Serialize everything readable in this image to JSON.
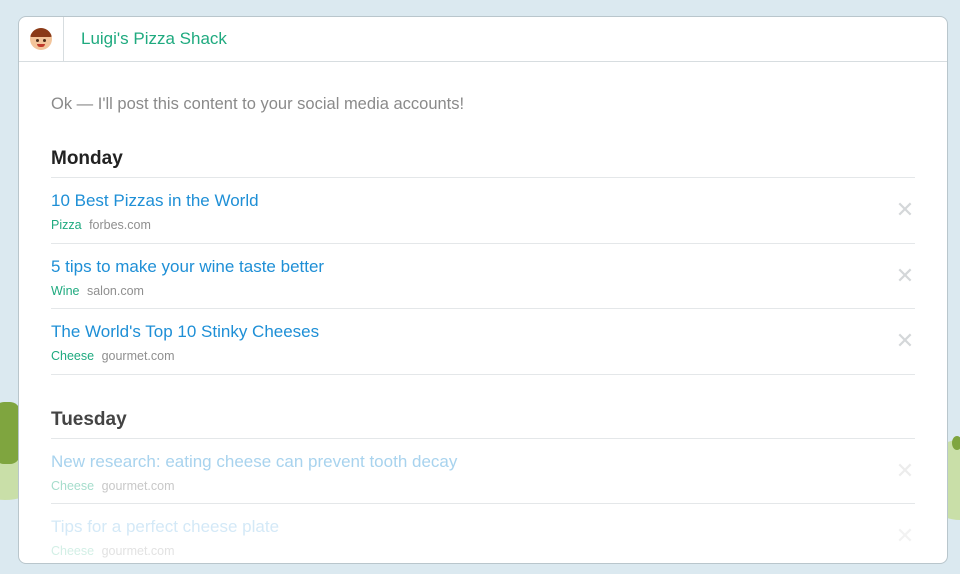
{
  "header": {
    "business_name": "Luigi's Pizza Shack",
    "avatar_icon": "chef-avatar-icon"
  },
  "intro": "Ok — I'll post this content to your social media accounts!",
  "colors": {
    "brand_green": "#1faa7f",
    "link_blue": "#1e8fd6",
    "background": "#dbe9f0"
  },
  "schedule": [
    {
      "day": "Monday",
      "items": [
        {
          "title": "10 Best Pizzas in the World",
          "tag": "Pizza",
          "source": "forbes.com"
        },
        {
          "title": "5 tips to make your wine taste better",
          "tag": "Wine",
          "source": "salon.com"
        },
        {
          "title": "The World's Top 10 Stinky Cheeses",
          "tag": "Cheese",
          "source": "gourmet.com"
        }
      ]
    },
    {
      "day": "Tuesday",
      "items": [
        {
          "title": "New research: eating cheese can prevent tooth decay",
          "tag": "Cheese",
          "source": "gourmet.com"
        },
        {
          "title": "Tips for a perfect cheese plate",
          "tag": "Cheese",
          "source": "gourmet.com"
        }
      ]
    }
  ],
  "remove_glyph": "✕"
}
